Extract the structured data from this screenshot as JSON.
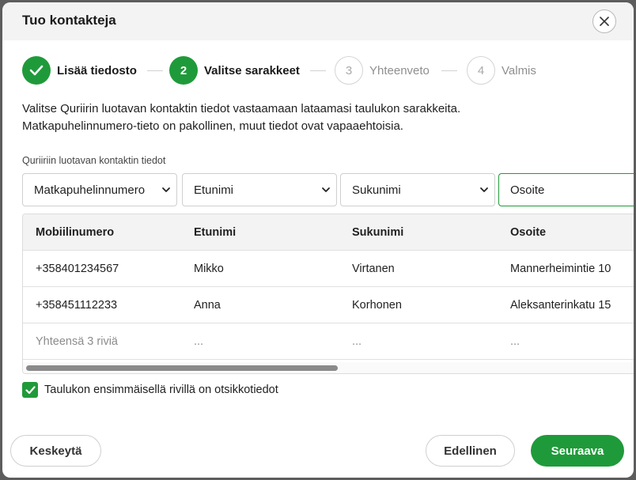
{
  "dialog": {
    "title": "Tuo kontakteja",
    "close_icon": "close-icon"
  },
  "stepper": {
    "steps": [
      {
        "number": "",
        "label": "Lisää tiedosto",
        "state": "done",
        "icon": "check-icon"
      },
      {
        "number": "2",
        "label": "Valitse sarakkeet",
        "state": "active"
      },
      {
        "number": "3",
        "label": "Yhteenveto",
        "state": "pending"
      },
      {
        "number": "4",
        "label": "Valmis",
        "state": "pending"
      }
    ]
  },
  "intro": {
    "line1": "Valitse Quriirin luotavan kontaktin tiedot vastaamaan lataamasi taulukon sarakkeita.",
    "line2": "Matkapuhelinnumero-tieto on pakollinen, muut tiedot ovat vapaaehtoisia."
  },
  "mapping": {
    "label": "Quriiriin luotavan kontaktin tiedot",
    "selects": [
      {
        "value": "Matkapuhelinnumero"
      },
      {
        "value": "Etunimi"
      },
      {
        "value": "Sukunimi"
      },
      {
        "value": "Osoite"
      }
    ]
  },
  "table": {
    "headers": [
      "Mobiilinumero",
      "Etunimi",
      "Sukunimi",
      "Osoite"
    ],
    "rows": [
      [
        "+358401234567",
        "Mikko",
        "Virtanen",
        "Mannerheimintie 10"
      ],
      [
        "+358451112233",
        "Anna",
        "Korhonen",
        "Aleksanterinkatu 15"
      ]
    ],
    "total_row": [
      "Yhteensä 3 riviä",
      "...",
      "...",
      "..."
    ]
  },
  "header_checkbox": {
    "checked": true,
    "label": "Taulukon ensimmäisellä rivillä on otsikkotiedot"
  },
  "footer": {
    "cancel_label": "Keskeytä",
    "back_label": "Edellinen",
    "next_label": "Seuraava"
  },
  "colors": {
    "accent": "#1f9a3a",
    "header_bg": "#f3f3f3",
    "overlay": "#5d5d5d"
  }
}
